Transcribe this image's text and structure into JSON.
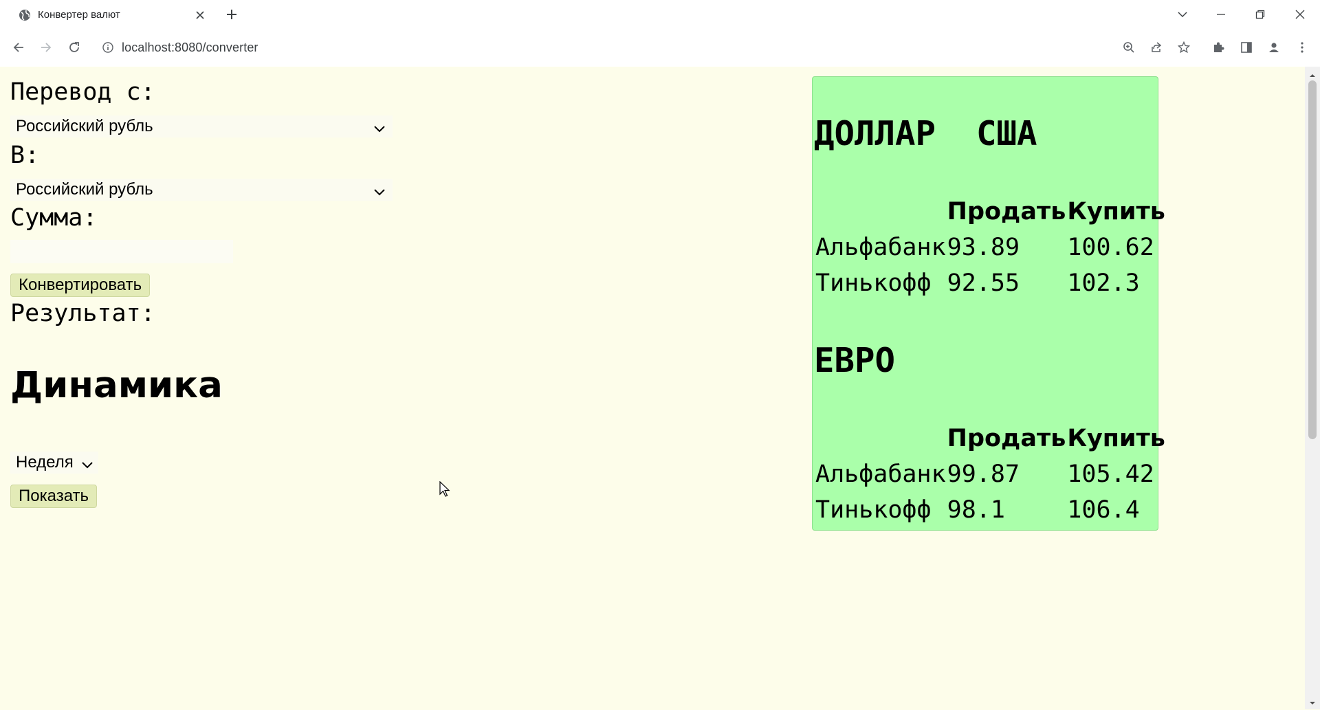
{
  "browser": {
    "tab_title": "Конвертер валют",
    "url": "localhost:8080/converter"
  },
  "converter": {
    "from_label": "Перевод с:",
    "from_value": "Российский рубль",
    "to_label": "В:",
    "to_value": "Российский рубль",
    "amount_label": "Сумма:",
    "amount_value": "",
    "convert_button": "Конвертировать",
    "result_label": "Результат:"
  },
  "dynamics": {
    "heading": "Динамика",
    "period_value": "Неделя",
    "show_button": "Показать"
  },
  "rates": {
    "usd": {
      "title": "ДОЛЛАР  США",
      "header_sell": "Продать",
      "header_buy": "Купить",
      "rows": [
        {
          "bank": "Альфабанк",
          "sell": "93.89",
          "buy": "100.62"
        },
        {
          "bank": "Тинькофф",
          "sell": "92.55",
          "buy": "102.3"
        }
      ]
    },
    "eur": {
      "title": "ЕВРО",
      "header_sell": "Продать",
      "header_buy": "Купить",
      "rows": [
        {
          "bank": "Альфабанк",
          "sell": "99.87",
          "buy": "105.42"
        },
        {
          "bank": "Тинькофф",
          "sell": "98.1",
          "buy": "106.4"
        }
      ]
    }
  },
  "icons": {
    "favicon": "globe-icon",
    "close": "close-icon",
    "new_tab": "plus-icon",
    "back": "back-arrow-icon",
    "forward": "forward-arrow-icon",
    "reload": "reload-icon",
    "site_info": "info-icon",
    "zoom": "zoom-icon",
    "share": "share-icon",
    "bookmark": "star-icon",
    "extensions": "puzzle-icon",
    "side_panel": "side-panel-icon",
    "profile": "profile-icon",
    "menu": "kebab-menu-icon"
  },
  "colors": {
    "page_background": "#fdfdea",
    "rates_panel": "#aaffaa",
    "button": "#e3ebb7"
  }
}
